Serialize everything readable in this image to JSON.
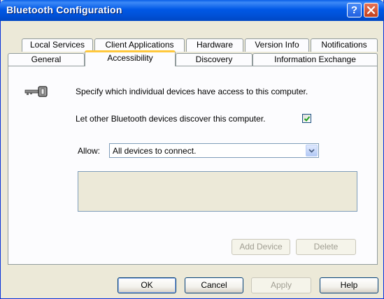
{
  "window": {
    "title": "Bluetooth Configuration",
    "help_glyph": "?"
  },
  "tabs": {
    "row1": [
      {
        "label": "Local Services"
      },
      {
        "label": "Client Applications"
      },
      {
        "label": "Hardware"
      },
      {
        "label": "Version Info"
      },
      {
        "label": "Notifications"
      }
    ],
    "row2": [
      {
        "label": "General"
      },
      {
        "label": "Accessibility"
      },
      {
        "label": "Discovery"
      },
      {
        "label": "Information Exchange"
      }
    ],
    "active": "Accessibility"
  },
  "accessibility": {
    "description": "Specify which individual devices have access to this computer.",
    "discover_label": "Let other Bluetooth devices discover this computer.",
    "discover_checked": true,
    "allow_label": "Allow:",
    "allow_value": "All devices to connect.",
    "add_device_label": "Add Device",
    "delete_label": "Delete"
  },
  "footer": {
    "ok": "OK",
    "cancel": "Cancel",
    "apply": "Apply",
    "help": "Help"
  },
  "icons": {
    "key": "key-icon",
    "check": "check-icon",
    "dropdown": "chevron-down-icon",
    "close": "close-icon"
  },
  "colors": {
    "titlebar": "#0054e3",
    "active_tab_accent": "#ffc83c",
    "dialog_bg": "#ece9d8"
  }
}
